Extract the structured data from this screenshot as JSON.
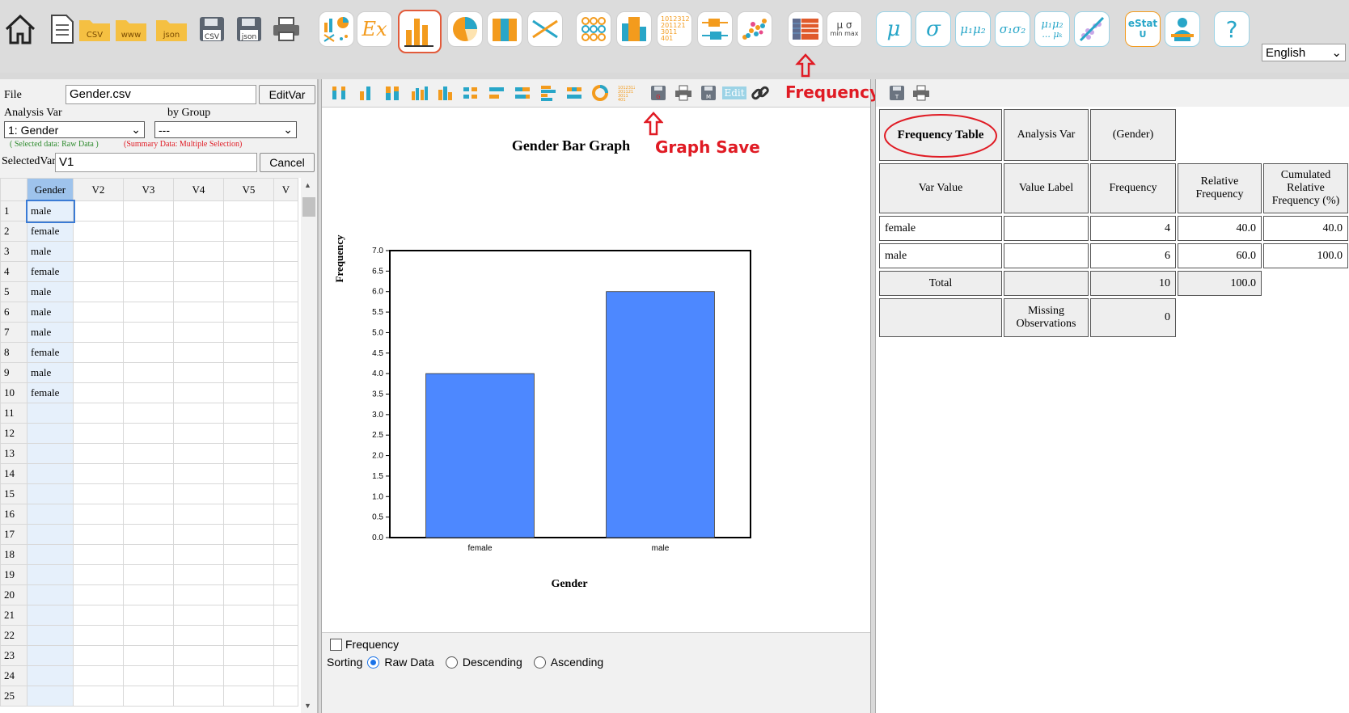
{
  "toolbar": {
    "icons": [
      "home-icon",
      "new-sheet-icon",
      "open-csv-folder-icon",
      "open-www-folder-icon",
      "open-json-folder-icon",
      "save-csv-icon",
      "save-json-icon",
      "print-icon",
      "eda-icon",
      "example-icon",
      "bar-graph-icon",
      "pie-chart-icon",
      "band-graph-icon",
      "line-graph-icon",
      "dot-graph-icon",
      "histogram-icon",
      "stem-leaf-icon",
      "box-plot-icon",
      "scatter-plot-icon",
      "frequency-table-icon",
      "basic-stats-icon",
      "mu-test-icon",
      "sigma-test-icon",
      "two-means-test-icon",
      "two-variances-icon",
      "anova-icon",
      "regression-icon",
      "estat-u-icon",
      "teacher-icon",
      "help-icon"
    ],
    "folder_labels": {
      "csv": "CSV",
      "www": "www",
      "json": "json"
    },
    "save_labels": {
      "csv": "CSV",
      "json": "json"
    },
    "example_label": "Ex",
    "stats_label": {
      "mu": "μ",
      "sigma": "σ",
      "mu12": "μ₁μ₂",
      "sigma12": "σ₁σ₂",
      "muk_top": "μ₁μ₂",
      "muk_bottom": "... μₖ",
      "minmax_top": "μ  σ",
      "minmax_bottom": "min max"
    },
    "estat_label": {
      "top": "eStat",
      "bottom": "U"
    },
    "help_label": "?",
    "stemleaf_lines": [
      "1012312",
      "201121",
      "3011",
      "401"
    ],
    "language": "English"
  },
  "left": {
    "file_label": "File",
    "file_value": "Gender.csv",
    "editvar_label": "EditVar",
    "analysis_var_label": "Analysis Var",
    "by_group_label": "by Group",
    "analysis_var_value": "1: Gender",
    "by_group_value": "---",
    "selected_note": "( Selected data: Raw Data )",
    "summary_note": "(Summary Data: Multiple Selection)",
    "selectedvar_label": "SelectedVar",
    "selectedvar_value": "V1",
    "cancel_label": "Cancel",
    "columns": [
      "Gender",
      "V2",
      "V3",
      "V4",
      "V5",
      "V"
    ],
    "rows": [
      "male",
      "female",
      "male",
      "female",
      "male",
      "male",
      "male",
      "female",
      "male",
      "female",
      "",
      "",
      "",
      "",
      "",
      "",
      "",
      "",
      "",
      "",
      "",
      "",
      "",
      "",
      ""
    ]
  },
  "middle": {
    "edit_label": "Edit",
    "annotation_graph_save": "Graph Save",
    "annotation_frequency": "Frequency",
    "frequency_checkbox_label": "Frequency",
    "sorting_label": "Sorting",
    "sort_options": [
      "Raw Data",
      "Descending",
      "Ascending"
    ],
    "sort_selected": "Raw Data"
  },
  "chart_data": {
    "type": "bar",
    "title": "Gender Bar Graph",
    "xlabel": "Gender",
    "ylabel": "Frequency",
    "categories": [
      "female",
      "male"
    ],
    "values": [
      4,
      6
    ],
    "ylim": [
      0,
      7
    ],
    "yticks": [
      "0.0",
      "0.5",
      "1.0",
      "1.5",
      "2.0",
      "2.5",
      "3.0",
      "3.5",
      "4.0",
      "4.5",
      "5.0",
      "5.5",
      "6.0",
      "6.5",
      "7.0"
    ],
    "bar_color": "#4d88ff",
    "grid": false
  },
  "right": {
    "header": {
      "title": "Frequency Table",
      "analysis_var": "Analysis Var",
      "var_name": "(Gender)"
    },
    "columns": [
      "Var Value",
      "Value Label",
      "Frequency",
      "Relative Frequency",
      "Cumulated Relative Frequency (%)"
    ],
    "rows": [
      {
        "value": "female",
        "label": "",
        "freq": "4",
        "rel": "40.0",
        "cum": "40.0"
      },
      {
        "value": "male",
        "label": "",
        "freq": "6",
        "rel": "60.0",
        "cum": "100.0"
      }
    ],
    "total": {
      "label": "Total",
      "freq": "10",
      "rel": "100.0"
    },
    "missing": {
      "label": "Missing Observations",
      "value": "0"
    }
  },
  "colors": {
    "accent_red": "#e01b24",
    "bar": "#4d88ff",
    "teal": "#28a6c8",
    "orange": "#f39b1d"
  }
}
